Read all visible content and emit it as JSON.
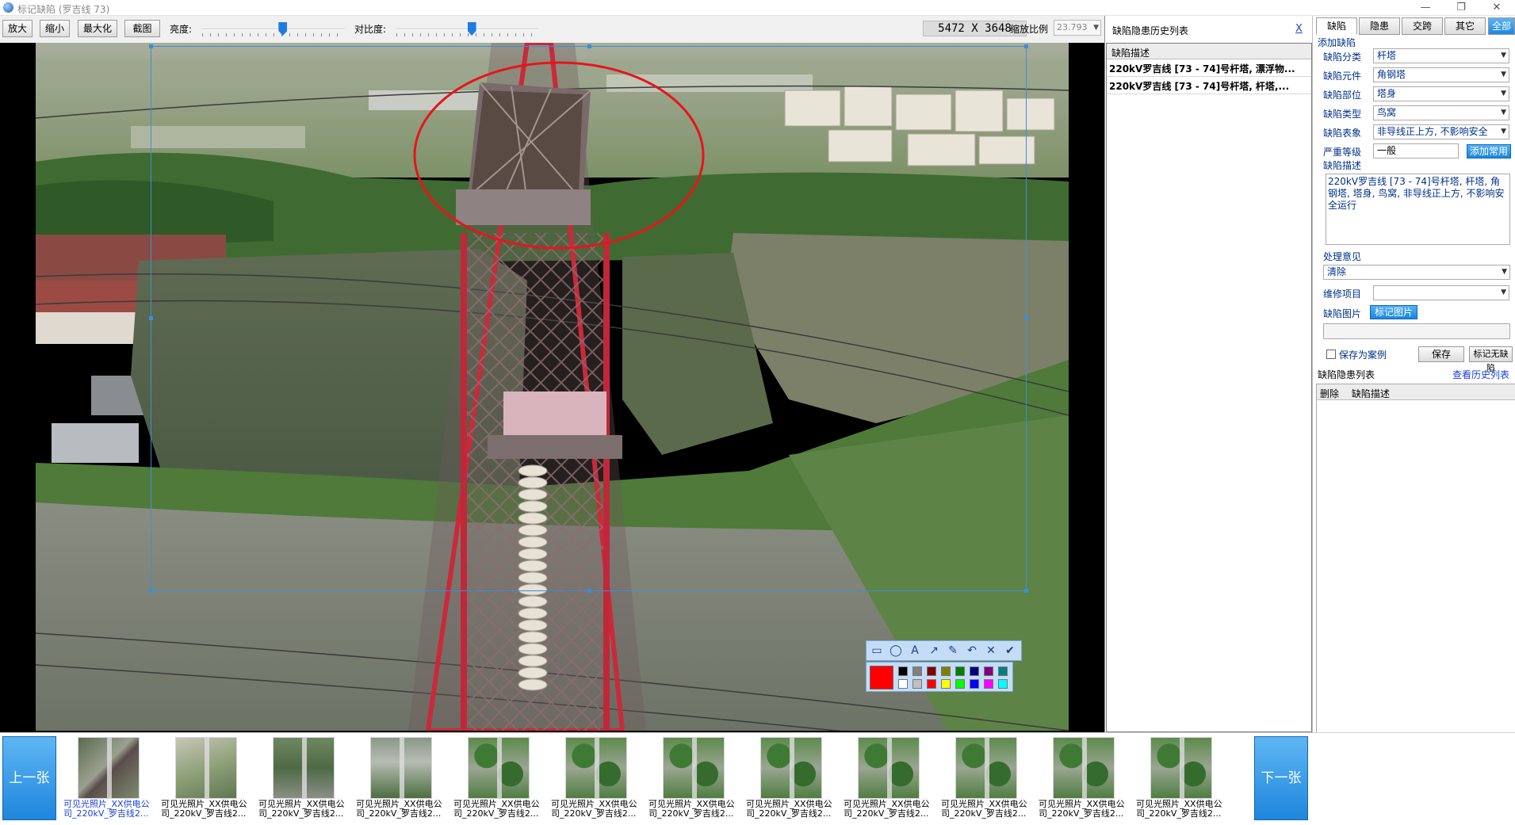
{
  "window": {
    "title": "标记缺陷 (罗吉线 73)",
    "minimize": "—",
    "restore": "❐",
    "close": "✕"
  },
  "toolbar": {
    "zoom_in": "放大",
    "zoom_out": "缩小",
    "maximize": "最大化",
    "screenshot": "截图",
    "brightness_label": "亮度:",
    "brightness_value": 0.57,
    "contrast_label": "对比度:",
    "contrast_value": 0.53,
    "image_size": "5472 X 3648",
    "zoom_ratio_label": "缩放比例",
    "zoom_ratio_value": "23.793"
  },
  "draw_tools": [
    "rectangle-icon",
    "ellipse-icon",
    "text-icon",
    "arrow-icon",
    "pen-icon",
    "undo-icon",
    "cancel-icon",
    "confirm-icon"
  ],
  "palette": {
    "current": "#ff0000",
    "colors": [
      "#000000",
      "#808080",
      "#800000",
      "#808000",
      "#008000",
      "#000080",
      "#800080",
      "#008080",
      "#ffffff",
      "#c0c0c0",
      "#ff0000",
      "#ffff00",
      "#00ff00",
      "#0000ff",
      "#ff00ff",
      "#00ffff"
    ]
  },
  "history": {
    "title": "缺陷隐患历史列表",
    "close": "X",
    "column": "缺陷描述",
    "rows": [
      "220kV罗吉线 [73 - 74]号杆塔, 漂浮物...",
      "220kV罗吉线 [73 - 74]号杆塔, 杆塔,..."
    ]
  },
  "right": {
    "tabs": [
      "缺陷",
      "隐患",
      "交跨",
      "其它",
      "全部"
    ],
    "add_defect": "添加缺陷",
    "fields": [
      {
        "label": "缺陷分类",
        "value": "杆塔"
      },
      {
        "label": "缺陷元件",
        "value": "角钢塔"
      },
      {
        "label": "缺陷部位",
        "value": "塔身"
      },
      {
        "label": "缺陷类型",
        "value": "鸟窝"
      },
      {
        "label": "缺陷表象",
        "value": "非导线正上方, 不影响安全"
      }
    ],
    "severity_label": "严重等级",
    "severity_value": "一般",
    "add_common": "添加常用",
    "desc_label": "缺陷描述",
    "desc_value": "220kV罗吉线 [73 - 74]号杆塔, 杆塔, 角钢塔, 塔身, 鸟窝, 非导线正上方, 不影响安全运行",
    "opinion_label": "处理意见",
    "opinion_value": "清除",
    "repair_label": "维修项目",
    "repair_value": "",
    "image_label": "缺陷图片",
    "mark_image": "标记图片",
    "save_case": "保存为案例",
    "save": "保存",
    "mark_no_defect": "标记无缺陷",
    "list_title": "缺陷隐患列表",
    "view_history": "查看历史列表",
    "list_cols": [
      "删除",
      "缺陷描述"
    ]
  },
  "filmstrip": {
    "prev": "上一张",
    "next": "下一张",
    "items": [
      {
        "line1": "可见光照片_XX供电公",
        "line2": "司_220kV_罗吉线2...",
        "kind": "nest",
        "selected": true
      },
      {
        "line1": "可见光照片_XX供电公",
        "line2": "司_220kV_罗吉线2...",
        "kind": "field",
        "selected": false
      },
      {
        "line1": "可见光照片_XX供电公",
        "line2": "司_220kV_罗吉线2...",
        "kind": "green",
        "selected": false
      },
      {
        "line1": "可见光照片_XX供电公",
        "line2": "司_220kV_罗吉线2...",
        "kind": "grey",
        "selected": false
      },
      {
        "line1": "可见光照片_XX供电公",
        "line2": "司_220kV_罗吉线2...",
        "kind": "trees",
        "selected": false
      },
      {
        "line1": "可见光照片_XX供电公",
        "line2": "司_220kV_罗吉线2...",
        "kind": "trees",
        "selected": false
      },
      {
        "line1": "可见光照片_XX供电公",
        "line2": "司_220kV_罗吉线2...",
        "kind": "trees",
        "selected": false
      },
      {
        "line1": "可见光照片_XX供电公",
        "line2": "司_220kV_罗吉线2...",
        "kind": "trees",
        "selected": false
      },
      {
        "line1": "可见光照片_XX供电公",
        "line2": "司_220kV_罗吉线2...",
        "kind": "trees",
        "selected": false
      },
      {
        "line1": "可见光照片_XX供电公",
        "line2": "司_220kV_罗吉线2...",
        "kind": "trees",
        "selected": false
      },
      {
        "line1": "可见光照片_XX供电公",
        "line2": "司_220kV_罗吉线2...",
        "kind": "trees",
        "selected": false
      },
      {
        "line1": "可见光照片_XX供电公",
        "line2": "司_220kV_罗吉线2...",
        "kind": "trees",
        "selected": false
      }
    ]
  }
}
